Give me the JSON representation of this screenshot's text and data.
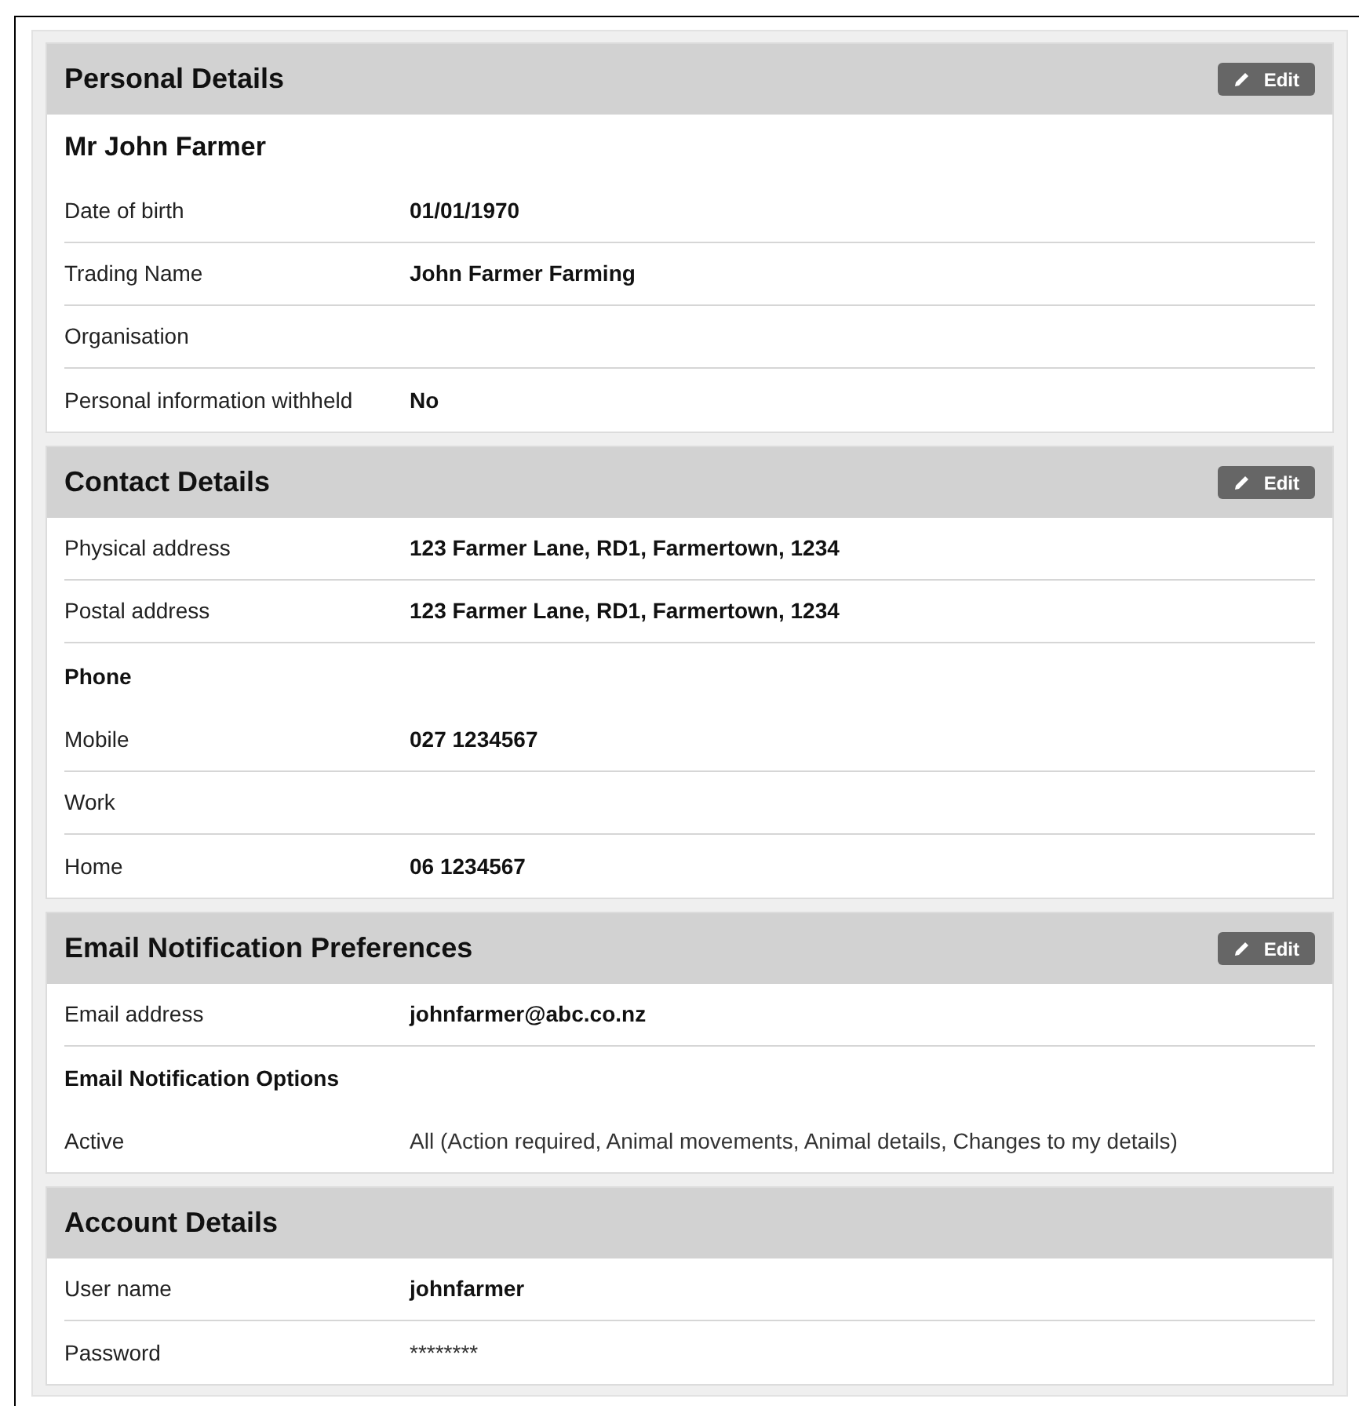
{
  "sections": [
    {
      "title": "Personal Details",
      "edit_button": "Edit",
      "rows": [
        {
          "kind": "heading",
          "label": "Mr John Farmer"
        },
        {
          "kind": "field",
          "label": "Date of birth",
          "value": "01/01/1970",
          "value_bold": true
        },
        {
          "kind": "field",
          "label": "Trading Name",
          "value": "John Farmer Farming",
          "value_bold": true
        },
        {
          "kind": "field",
          "label": "Organisation"
        },
        {
          "kind": "field",
          "label": "Personal information withheld",
          "value": "No",
          "value_bold": true
        }
      ]
    },
    {
      "title": "Contact Details",
      "edit_button": "Edit",
      "rows": [
        {
          "kind": "field",
          "label": "Physical address",
          "value": "123 Farmer Lane, RD1, Farmertown, 1234",
          "value_bold": true
        },
        {
          "kind": "field",
          "label": "Postal address",
          "value": "123 Farmer Lane, RD1, Farmertown, 1234",
          "value_bold": true
        },
        {
          "kind": "heading",
          "label": "Phone"
        },
        {
          "kind": "field",
          "label": "Mobile",
          "value": "027 1234567",
          "value_bold": true
        },
        {
          "kind": "field",
          "label": "Work"
        },
        {
          "kind": "field",
          "label": "Home",
          "value": "06 1234567",
          "value_bold": true
        }
      ]
    },
    {
      "title": "Email Notification Preferences",
      "edit_button": "Edit",
      "rows": [
        {
          "kind": "field",
          "label": "Email address",
          "value": "johnfarmer@abc.co.nz",
          "value_bold": true
        },
        {
          "kind": "subheading",
          "label": "Email Notification Options"
        },
        {
          "kind": "field",
          "label": "Active",
          "value": "All (Action required, Animal movements, Animal details, Changes to my details)",
          "value_bold": false
        }
      ]
    },
    {
      "title": "Account Details",
      "rows": [
        {
          "kind": "field",
          "label": "User name",
          "value": "johnfarmer",
          "value_bold": true
        },
        {
          "kind": "field",
          "label": "Password",
          "value": "********",
          "value_bold": false
        }
      ]
    }
  ]
}
